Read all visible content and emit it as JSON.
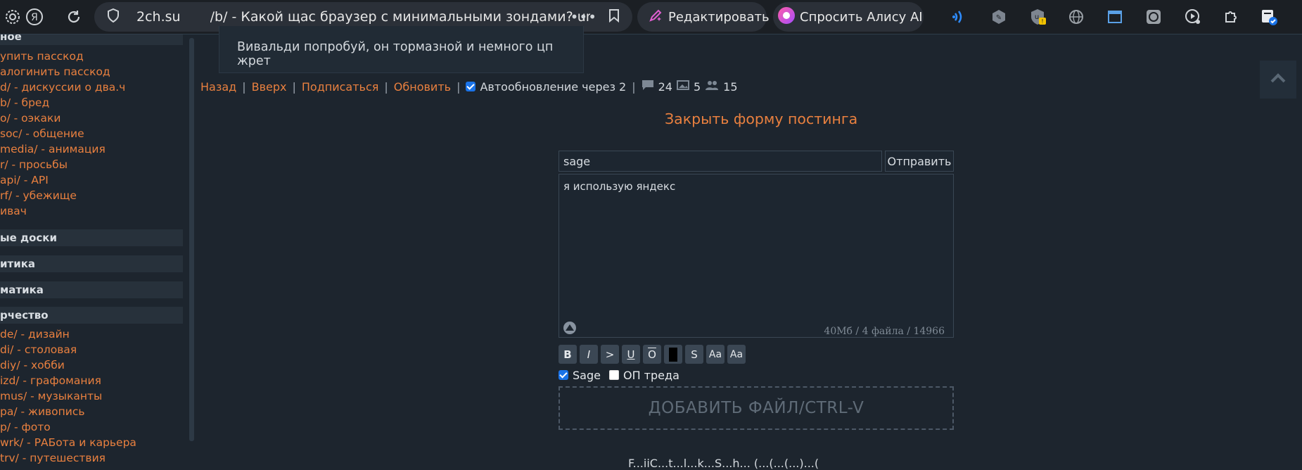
{
  "browser": {
    "domain": "2ch.su",
    "page_title": "/b/ - Какой щас браузер с минимальными зондами? ungo...",
    "edit_label": "Редактировать",
    "alice_label": "Спросить Алису AI"
  },
  "sidebar": {
    "top_section": "ное",
    "top_links": [
      "упить пасскод",
      "алогинить пасскод",
      "d/ - дискуссии о два.ч",
      "b/ - бред",
      "o/ - оэкаки",
      "soc/ - общение",
      "media/ - анимация",
      "r/ - просьбы",
      "api/ - API",
      "rf/ - убежище",
      "ивач"
    ],
    "sections": [
      "ые доски",
      "итика",
      "матика",
      "рчество"
    ],
    "bottom_links": [
      "de/ - дизайн",
      "di/ - столовая",
      "diy/ - хобби",
      "izd/ - графомания",
      "mus/ - музыканты",
      "pa/ - живопись",
      "p/ - фото",
      "wrk/ - РАБота и карьера",
      "trv/ - путешествия"
    ]
  },
  "post": {
    "text": "Вивальди попробуй, он тормазной и немного цп жрет"
  },
  "nav": {
    "back": "Назад",
    "up": "Вверх",
    "subscribe": "Подписаться",
    "refresh": "Обновить",
    "autorefresh": "Автообновление через 2",
    "posts_count": "24",
    "images_count": "5",
    "users_count": "15"
  },
  "form": {
    "close_label": "Закрыть форму постинга",
    "subject_value": "sage",
    "send_label": "Отправить",
    "message_value": "я использую яндекс",
    "limits": "40Мб / 4 файла / 14966",
    "format_buttons": [
      "B",
      "I",
      ">",
      "U",
      "O",
      "",
      "S",
      "Aa",
      "Aa"
    ],
    "sage_label": "Sage",
    "op_label": "ОП треда",
    "dropzone_label": "ДОБАВИТЬ ФАЙЛ/CTRL-V"
  },
  "footer": {
    "partial_text": "F...iiC...t...l...k...S...h... (...(...(...)...("
  },
  "colors": {
    "link": "#e9803f",
    "background": "#1d252e",
    "accent": "#1a73e8"
  }
}
